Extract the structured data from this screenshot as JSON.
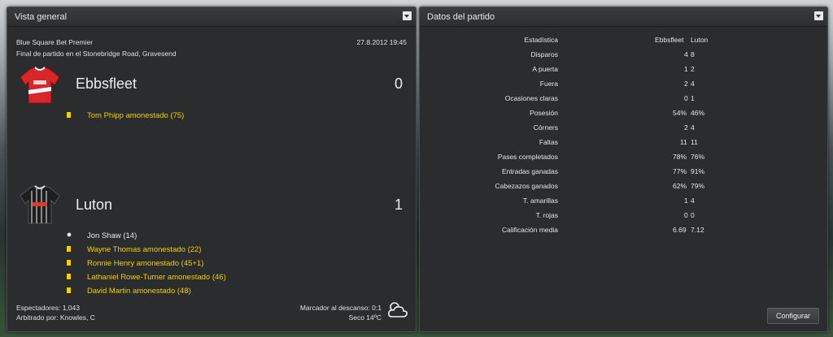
{
  "overview": {
    "title": "Vista general",
    "competition": "Blue Square Bet Premier",
    "datetime": "27.8.2012 19:45",
    "venue_line": "Final de partido en el Stonebridge Road, Gravesend",
    "home": {
      "name": "Ebbsfleet",
      "score": "0",
      "events": [
        {
          "icon": "yellow-card",
          "text": "Tom Phipp amonestado (75)"
        }
      ]
    },
    "away": {
      "name": "Luton",
      "score": "1",
      "events": [
        {
          "icon": "goal",
          "text": "Jon Shaw (14)"
        },
        {
          "icon": "yellow-card",
          "text": "Wayne Thomas amonestado (22)"
        },
        {
          "icon": "yellow-card",
          "text": "Ronnie Henry amonestado (45+1)"
        },
        {
          "icon": "yellow-card",
          "text": "Lathaniel Rowe-Turner amonestado (46)"
        },
        {
          "icon": "yellow-card",
          "text": "David Martin amonestado (48)"
        }
      ]
    },
    "attendance": "Espectadores: 1,043",
    "referee": "Arbitrado por: Knowles, C",
    "halftime": "Marcador al descanso: 0:1",
    "weather": "Seco 14ºC",
    "weather_icon": "cloud-icon"
  },
  "match_data": {
    "title": "Datos del partido",
    "headers": {
      "stat": "Estadística",
      "home": "Ebbsfleet",
      "away": "Luton"
    },
    "stats": [
      {
        "label": "Disparos",
        "home": "4",
        "away": "8"
      },
      {
        "label": "A puerta",
        "home": "1",
        "away": "2"
      },
      {
        "label": "Fuera",
        "home": "2",
        "away": "4"
      },
      {
        "label": "Ocasiones claras",
        "home": "0",
        "away": "1"
      },
      {
        "label": "Posesión",
        "home": "54%",
        "away": "46%"
      },
      {
        "label": "Córners",
        "home": "2",
        "away": "4"
      },
      {
        "label": "Faltas",
        "home": "11",
        "away": "11"
      },
      {
        "label": "Pases completados",
        "home": "78%",
        "away": "76%"
      },
      {
        "label": "Entradas ganadas",
        "home": "77%",
        "away": "91%"
      },
      {
        "label": "Cabezazos ganados",
        "home": "62%",
        "away": "79%"
      },
      {
        "label": "T. amarillas",
        "home": "1",
        "away": "4"
      },
      {
        "label": "T. rojas",
        "home": "0",
        "away": "0"
      },
      {
        "label": "Calificación media",
        "home": "6.69",
        "away": "7.12"
      }
    ],
    "configure_label": "Configurar"
  },
  "colors": {
    "accent_yellow": "#f0d000",
    "panel_bg": "#2a2c2d",
    "home_shirt": "#d8262b",
    "away_shirt": "#1e1e1e"
  }
}
